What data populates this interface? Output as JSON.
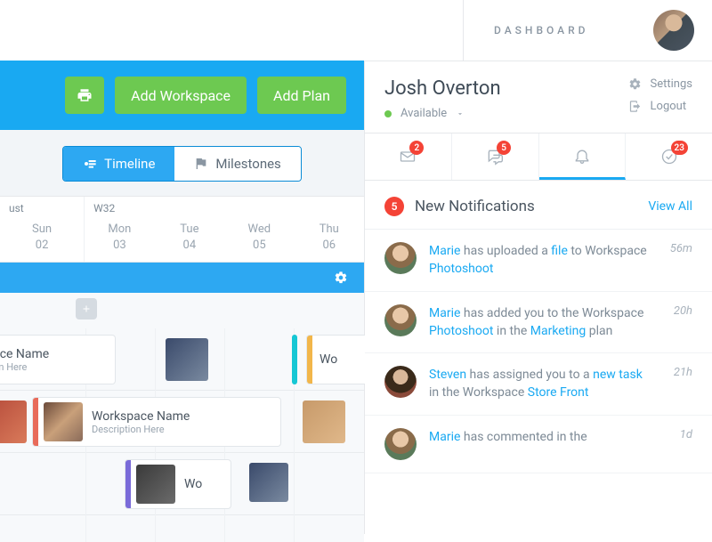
{
  "header": {
    "dashboard_label": "DASHBOARD"
  },
  "toolbar": {
    "add_workspace": "Add Workspace",
    "add_plan": "Add Plan"
  },
  "view_toggle": {
    "timeline": "Timeline",
    "milestones": "Milestones"
  },
  "calendar": {
    "month_left": "ust",
    "week_label": "W32",
    "days": [
      {
        "dow": "Sun",
        "num": "02"
      },
      {
        "dow": "Mon",
        "num": "03"
      },
      {
        "dow": "Tue",
        "num": "04"
      },
      {
        "dow": "Wed",
        "num": "05"
      },
      {
        "dow": "Thu",
        "num": "06"
      }
    ]
  },
  "cards": {
    "c1_title": "space Name",
    "c1_desc": "iption Here",
    "c2_title": "Workspace Name",
    "c2_desc": "Description Here",
    "c3_title": "Wo",
    "c4_title": "Wo"
  },
  "user": {
    "name": "Josh Overton",
    "status": "Available",
    "settings": "Settings",
    "logout": "Logout"
  },
  "tabs": {
    "mail_badge": "2",
    "chat_badge": "5",
    "check_badge": "23"
  },
  "notif_header": {
    "count": "5",
    "title": "New Notifications",
    "view_all": "View All"
  },
  "notifications": [
    {
      "actor": "Marie",
      "text1": " has uploaded a ",
      "link1": "file",
      "text2": " to Workspace ",
      "link2": "Photoshoot",
      "text3": "",
      "time": "56m",
      "avatar": "av-marie"
    },
    {
      "actor": "Marie",
      "text1": " has added you to the Workspace ",
      "link1": "Photoshoot",
      "text2": " in the ",
      "link2": "Marketing",
      "text3": " plan",
      "time": "20h",
      "avatar": "av-marie"
    },
    {
      "actor": "Steven",
      "text1": " has assigned you to a ",
      "link1": "new task",
      "text2": " in the Workspace ",
      "link2": "Store Front",
      "text3": "",
      "time": "21h",
      "avatar": "av-steven"
    },
    {
      "actor": "Marie",
      "text1": " has commented in the",
      "link1": "",
      "text2": "",
      "link2": "",
      "text3": "",
      "time": "1d",
      "avatar": "av-marie"
    }
  ]
}
